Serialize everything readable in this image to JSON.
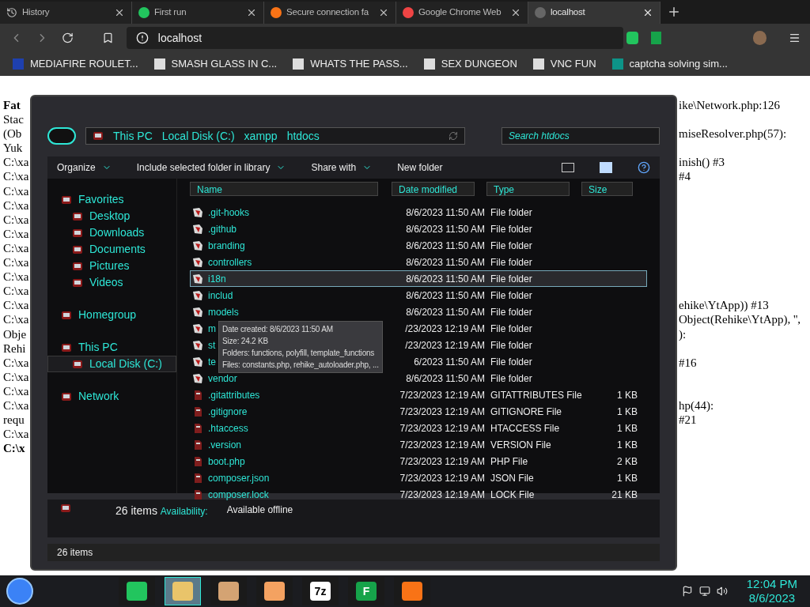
{
  "browser": {
    "tabs": [
      {
        "title": "History",
        "selected": false
      },
      {
        "title": "First run",
        "selected": false
      },
      {
        "title": "Secure connection fa",
        "selected": false
      },
      {
        "title": "Google Chrome Web",
        "selected": false
      },
      {
        "title": "localhost",
        "selected": true
      }
    ],
    "address": "localhost",
    "bookmarks": [
      "MEDIAFIRE ROULET...",
      "SMASH GLASS IN C...",
      "WHATS THE PASS...",
      "SEX DUNGEON",
      "VNC FUN",
      "captcha solving sim..."
    ]
  },
  "page_lines": [
    {
      "left": "Fat",
      "bold": true,
      "right": "ike\\Network.php:126"
    },
    {
      "left": "Stac",
      "bold": false
    },
    {
      "left": "(Ob",
      "bold": false,
      "right": "miseResolver.php(57):"
    },
    {
      "left": "Yuk",
      "bold": false
    },
    {
      "left": "C:\\xa",
      "bold": false,
      "right": "inish() #3"
    },
    {
      "left": "C:\\xa",
      "bold": false,
      "right": "#4"
    },
    {
      "left": "C:\\xa",
      "bold": false
    },
    {
      "left": "C:\\xa",
      "bold": false
    },
    {
      "left": "C:\\xa",
      "bold": false
    },
    {
      "left": "C:\\xa",
      "bold": false
    },
    {
      "left": "C:\\xa",
      "bold": false
    },
    {
      "left": "C:\\xa",
      "bold": false
    },
    {
      "left": "C:\\xa",
      "bold": false
    },
    {
      "left": "C:\\xa",
      "bold": false
    },
    {
      "left": "C:\\xa",
      "bold": false,
      "right": "ehike\\YtApp)) #13"
    },
    {
      "left": "C:\\xa",
      "bold": false,
      "right": "Object(Rehike\\YtApp), '',"
    },
    {
      "left": "Obje",
      "bold": false,
      "right": "):"
    },
    {
      "left": "Rehi",
      "bold": false
    },
    {
      "left": "C:\\xa",
      "bold": false,
      "right": "#16"
    },
    {
      "left": "C:\\xa",
      "bold": false
    },
    {
      "left": "C:\\xa",
      "bold": false
    },
    {
      "left": "C:\\xa",
      "bold": false,
      "right": "hp(44):"
    },
    {
      "left": "requ",
      "bold": false,
      "right": "#21"
    },
    {
      "left": "C:\\xa",
      "bold": false
    },
    {
      "left": "C:\\x",
      "bold": true
    }
  ],
  "explorer": {
    "breadcrumb": [
      "This PC",
      "Local Disk (C:)",
      "xampp",
      "htdocs"
    ],
    "search": {
      "placeholder": "Search htdocs"
    },
    "toolbar": [
      "Organize",
      "Include selected folder in library",
      "Share with"
    ],
    "new_folder": "New folder",
    "sidebar": [
      {
        "label": "Favorites",
        "selected": false,
        "children": [
          {
            "label": "Desktop",
            "selected": false
          },
          {
            "label": "Downloads",
            "selected": false
          },
          {
            "label": "Documents",
            "selected": false
          },
          {
            "label": "Pictures",
            "selected": false
          },
          {
            "label": "Videos",
            "selected": false
          }
        ]
      },
      {
        "label": "Homegroup",
        "selected": false
      },
      {
        "label": "This PC",
        "selected": false,
        "children": [
          {
            "label": "Local Disk (C:)",
            "selected": true
          }
        ]
      },
      {
        "label": "Network",
        "selected": false
      }
    ],
    "columns": [
      "Name",
      "Date modified",
      "Type",
      "Size"
    ],
    "rows": [
      {
        "kind": "folder",
        "name": ".git-hooks",
        "date": "8/6/2023 11:50 AM",
        "type": "File folder",
        "selected": false
      },
      {
        "kind": "folder",
        "name": ".github",
        "date": "8/6/2023 11:50 AM",
        "type": "File folder",
        "selected": false
      },
      {
        "kind": "folder",
        "name": "branding",
        "date": "8/6/2023 11:50 AM",
        "type": "File folder",
        "selected": false
      },
      {
        "kind": "folder",
        "name": "controllers",
        "date": "8/6/2023 11:50 AM",
        "type": "File folder",
        "selected": false
      },
      {
        "kind": "folder",
        "name": "i18n",
        "date": "8/6/2023 11:50 AM",
        "type": "File folder",
        "selected": true
      },
      {
        "kind": "folder",
        "name": "includ",
        "date": "8/6/2023 11:50 AM",
        "type": "File folder",
        "selected": false
      },
      {
        "kind": "folder",
        "name": "models",
        "date": "8/6/2023 11:50 AM",
        "type": "File folder",
        "selected": false
      },
      {
        "kind": "folder",
        "name": "m",
        "date": "/23/2023 12:19 AM",
        "type": "File folder",
        "selected": false
      },
      {
        "kind": "folder",
        "name": "st",
        "date": "/23/2023 12:19 AM",
        "type": "File folder",
        "selected": false
      },
      {
        "kind": "folder",
        "name": "te",
        "date": "6/2023 11:50 AM",
        "type": "File folder",
        "selected": false
      },
      {
        "kind": "folder",
        "name": "vendor",
        "date": "8/6/2023 11:50 AM",
        "type": "File folder",
        "selected": false
      },
      {
        "kind": "file",
        "name": ".gitattributes",
        "date": "7/23/2023 12:19 AM",
        "type": "GITATTRIBUTES File",
        "size": "1 KB",
        "selected": false
      },
      {
        "kind": "file",
        "name": ".gitignore",
        "date": "7/23/2023 12:19 AM",
        "type": "GITIGNORE File",
        "size": "1 KB",
        "selected": false
      },
      {
        "kind": "file",
        "name": ".htaccess",
        "date": "7/23/2023 12:19 AM",
        "type": "HTACCESS File",
        "size": "1 KB",
        "selected": false
      },
      {
        "kind": "file",
        "name": ".version",
        "date": "7/23/2023 12:19 AM",
        "type": "VERSION File",
        "size": "1 KB",
        "selected": false
      },
      {
        "kind": "file",
        "name": "boot.php",
        "date": "7/23/2023 12:19 AM",
        "type": "PHP File",
        "size": "2 KB",
        "selected": false
      },
      {
        "kind": "file",
        "name": "composer.json",
        "date": "7/23/2023 12:19 AM",
        "type": "JSON File",
        "size": "1 KB",
        "selected": false
      },
      {
        "kind": "file",
        "name": "composer.lock",
        "date": "7/23/2023 12:19 AM",
        "type": "LOCK File",
        "size": "21 KB",
        "selected": false
      }
    ],
    "tooltip": [
      "Date created: 8/6/2023 11:50 AM",
      "Size: 24.2 KB",
      "Folders: functions, polyfill, template_functions",
      "Files: constants.php, rehike_autoloader.php, ..."
    ],
    "details": {
      "count": "26 items",
      "label": "Availability:",
      "value": "Available offline"
    },
    "status": "26 items"
  },
  "taskbar": {
    "apps": [
      {
        "kind": "chat",
        "selected": false
      },
      {
        "kind": "explorer",
        "selected": true
      },
      {
        "kind": "arrow",
        "selected": false
      },
      {
        "kind": "handshake",
        "selected": false
      },
      {
        "kind": "zip",
        "label": "7z",
        "selected": false
      },
      {
        "kind": "diamond",
        "label": "F",
        "selected": false
      },
      {
        "kind": "xampp",
        "selected": false
      }
    ],
    "time": "12:04 PM",
    "date": "8/6/2023"
  }
}
